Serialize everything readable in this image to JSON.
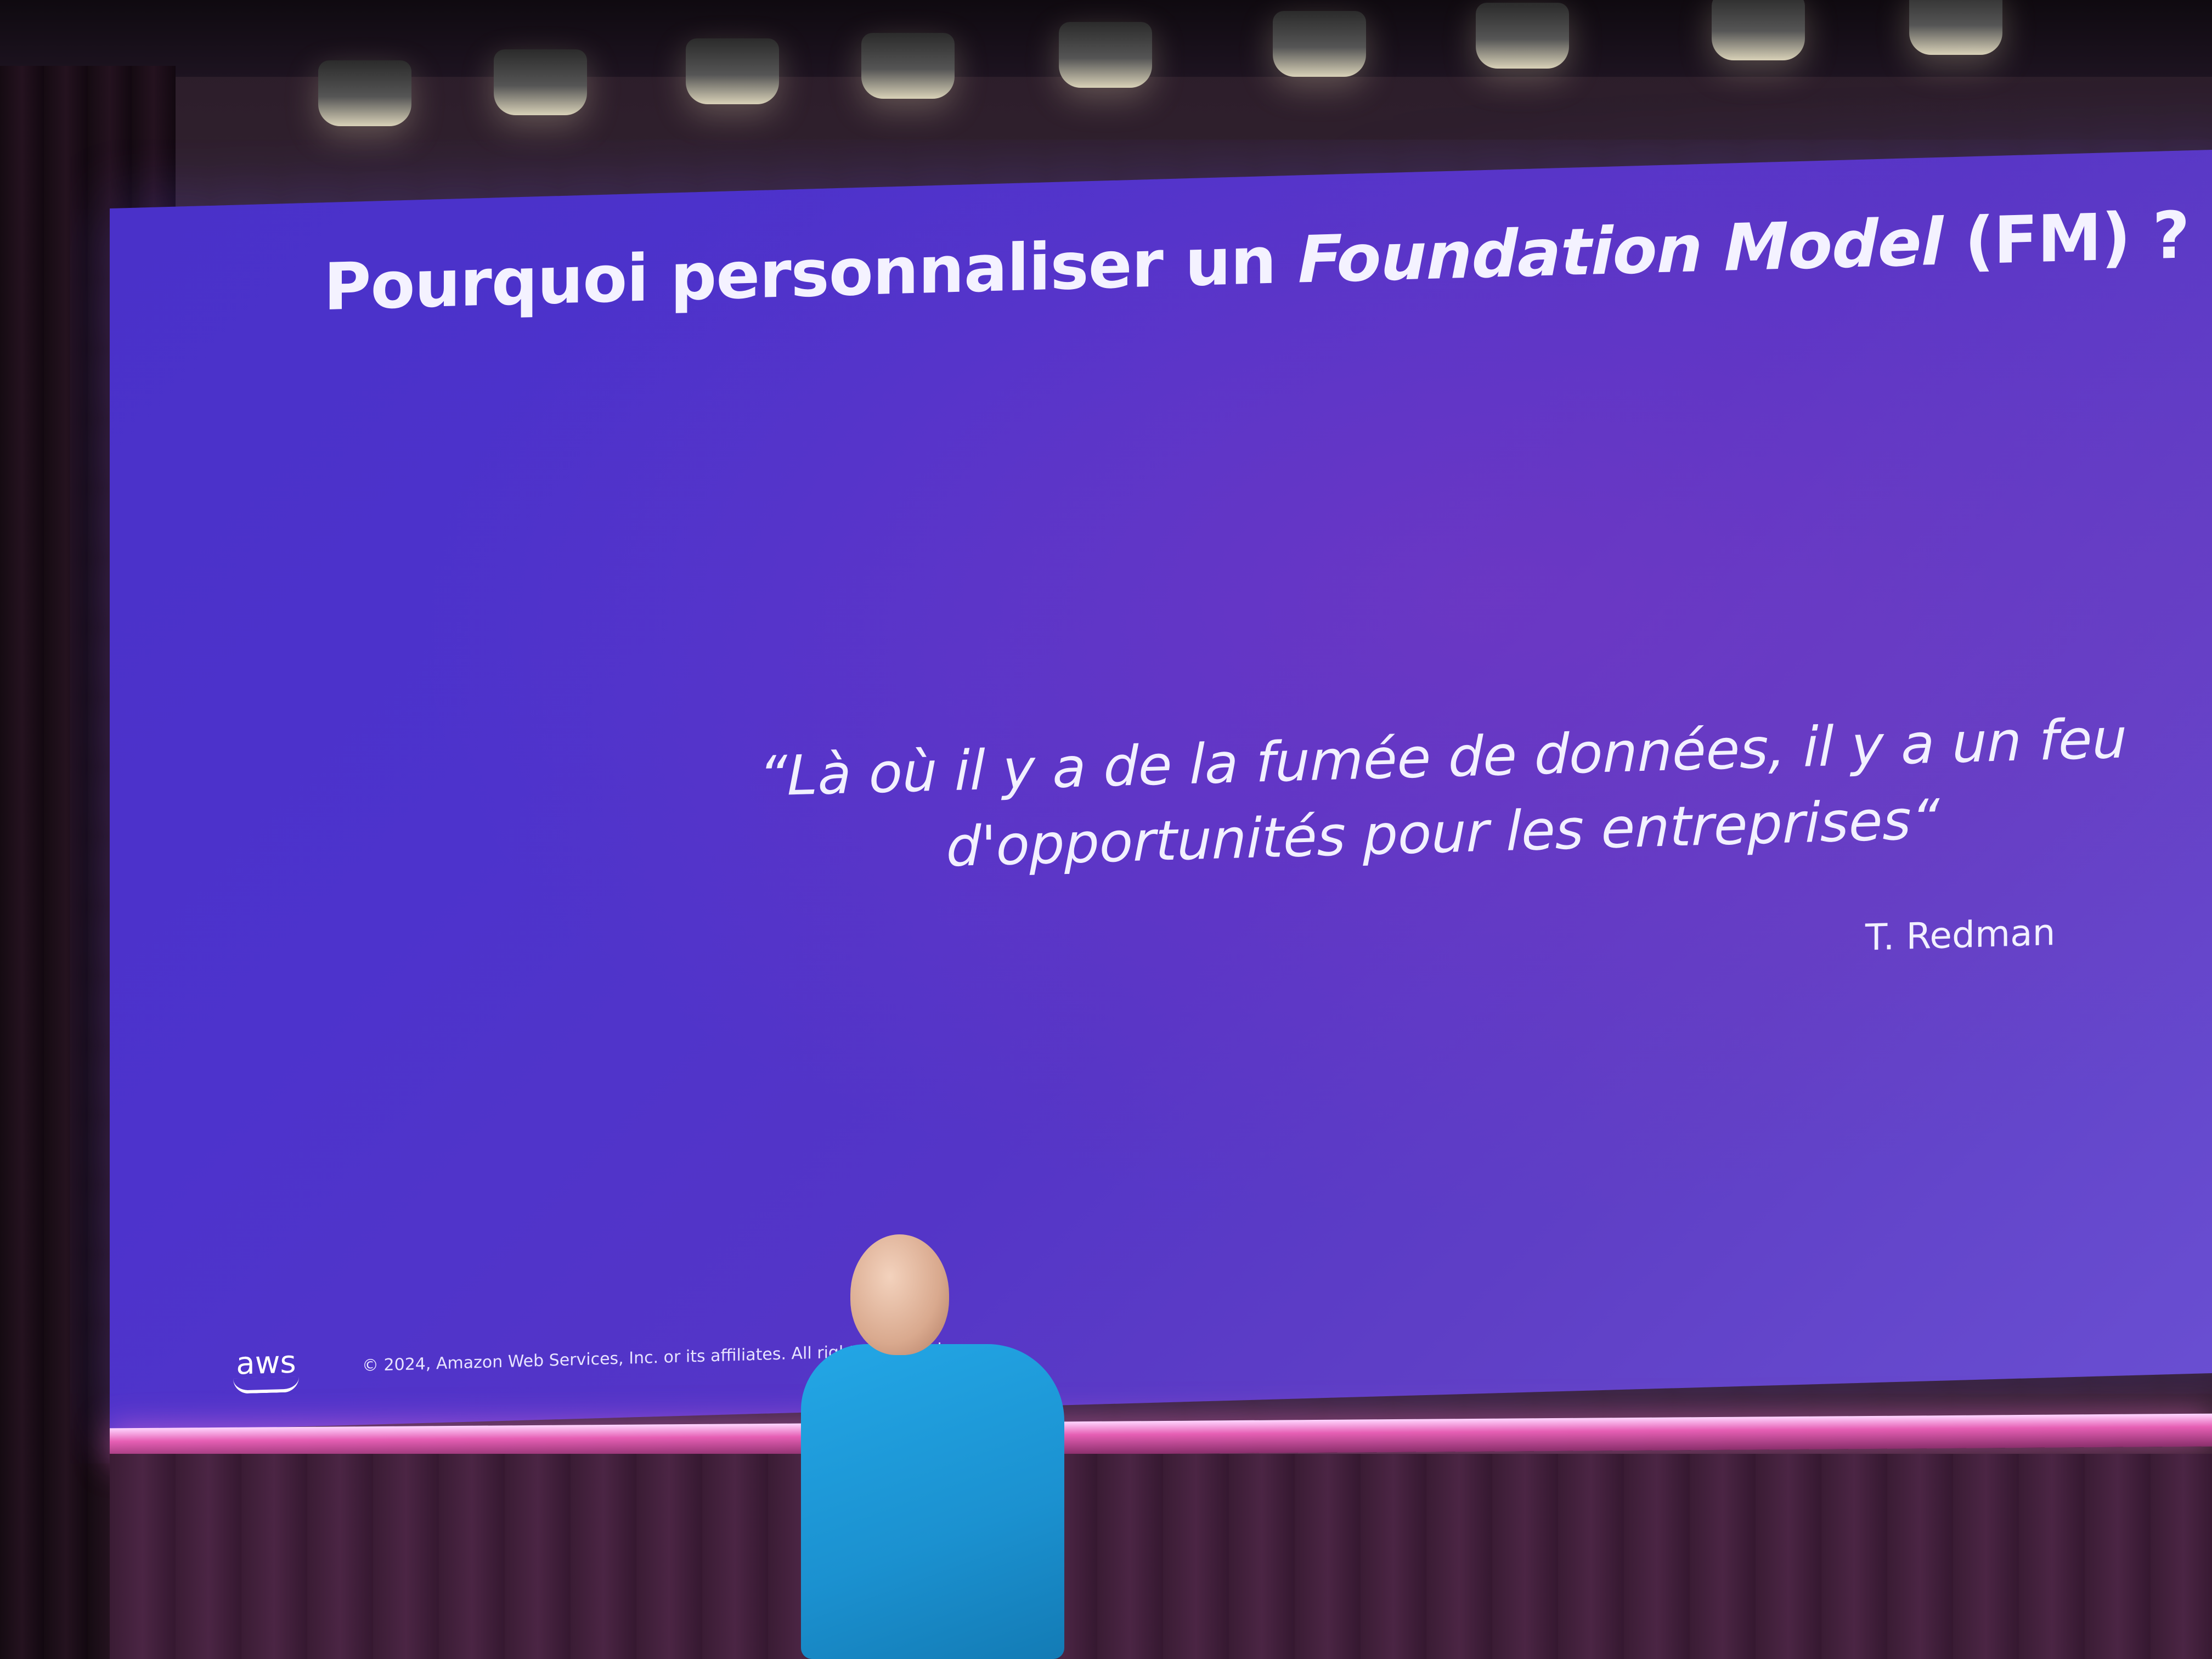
{
  "slide": {
    "title_plain": "Pourquoi personnaliser un ",
    "title_italic": "Foundation Model",
    "title_tail": " (FM) ?",
    "quote": "“Là où il y a de la fumée de données, il y a un feu d'opportunités pour les entreprises“",
    "author": "T. Redman",
    "logo_text": "aws",
    "copyright": "© 2024, Amazon Web Services, Inc. or its affiliates. All rights reserved."
  },
  "colors": {
    "slide_background": "#4d33cc",
    "slide_text": "#f4f2ff",
    "stage_strip": "#e65fb4",
    "presenter_shirt": "#1b91d0"
  },
  "icons": [
    "aws-logo-icon"
  ]
}
